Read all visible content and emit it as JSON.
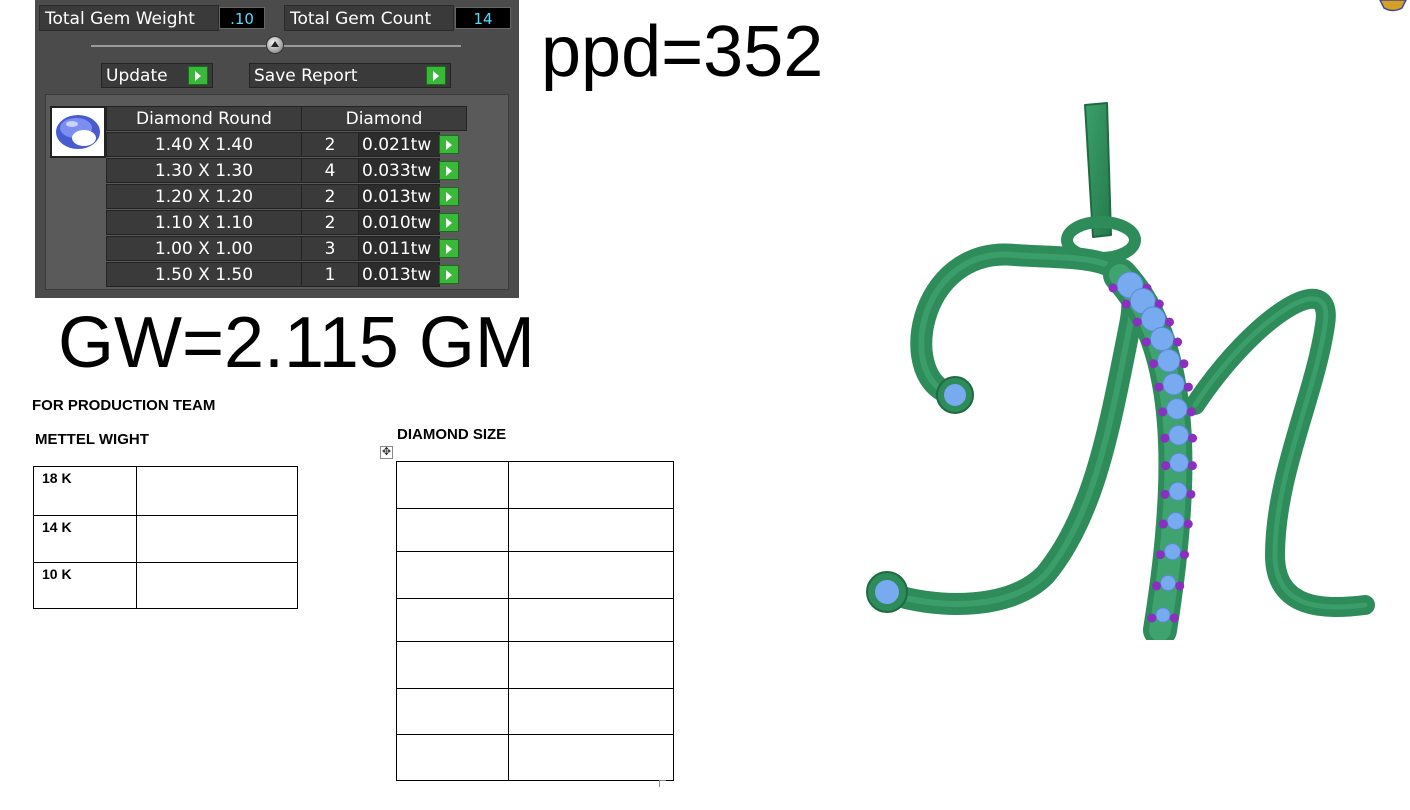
{
  "gem_report": {
    "total_gem_weight_label": "Total Gem Weight",
    "total_gem_weight_value": ".10",
    "total_gem_count_label": "Total Gem Count",
    "total_gem_count_value": "14",
    "update_label": "Update",
    "save_report_label": "Save Report",
    "col_shape": "Diamond Round",
    "col_type": "Diamond",
    "rows": [
      {
        "size": "1.40 X 1.40",
        "count": "2",
        "weight": "0.021tw"
      },
      {
        "size": "1.30 X 1.30",
        "count": "4",
        "weight": "0.033tw"
      },
      {
        "size": "1.20 X 1.20",
        "count": "2",
        "weight": "0.013tw"
      },
      {
        "size": "1.10 X 1.10",
        "count": "2",
        "weight": "0.010tw"
      },
      {
        "size": "1.00 X 1.00",
        "count": "3",
        "weight": "0.011tw"
      },
      {
        "size": "1.50 X 1.50",
        "count": "1",
        "weight": "0.013tw"
      }
    ]
  },
  "ppd_text": "ppd=352",
  "gw_text": "GW=2.115 GM",
  "production": {
    "heading": "FOR PRODUCTION TEAM",
    "metal_heading": "METTEL WIGHT",
    "metal_rows": [
      "18 K",
      "14 K",
      "10 K"
    ],
    "diamond_heading": "DIAMOND SIZE"
  },
  "colors": {
    "metal_green": "#2e8b5a",
    "stone_blue": "#78aaf0",
    "stone_purple": "#8a2fc0",
    "panel_bg": "#4b4b4b",
    "value_cyan": "#55ddff",
    "button_green": "#39b83a"
  },
  "icons": [
    "gem-thumbnail-icon",
    "arrow-right-icon",
    "slider-knob-icon",
    "table-move-handle-icon",
    "logo-icon"
  ]
}
